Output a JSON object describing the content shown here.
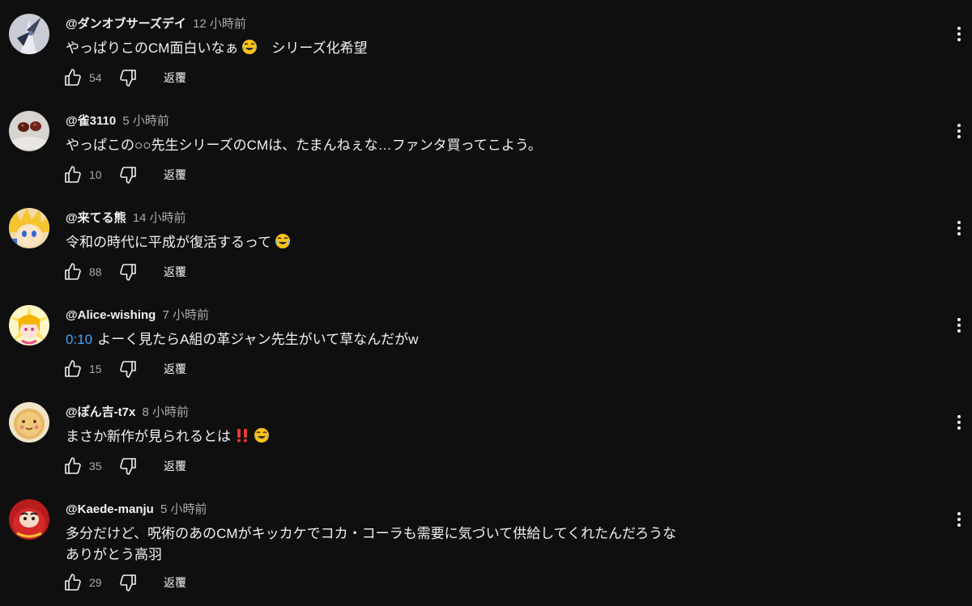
{
  "reply_label": "返覆",
  "comments": [
    {
      "author": "@ダンオブサーズデイ",
      "time": "12 小時前",
      "timestamp": "",
      "text": "やっぱりこのCM面白いなぁ",
      "emoji_after_text": "face-with-tears-of-joy",
      "text_after_emoji": "　シリーズ化希望",
      "line2": "",
      "likes": "54",
      "avatar": "robot-avatar"
    },
    {
      "author": "@雀3110",
      "time": "5 小時前",
      "timestamp": "",
      "text": "やっぱこの○○先生シリーズのCMは、たまんねぇな…ファンタ買ってこよう。",
      "emoji_after_text": "",
      "text_after_emoji": "",
      "line2": "",
      "likes": "10",
      "avatar": "chocolates-avatar"
    },
    {
      "author": "@来てる熊",
      "time": "14 小時前",
      "timestamp": "",
      "text": "令和の時代に平成が復活するって",
      "emoji_after_text": "face-with-tears-of-joy",
      "text_after_emoji": "",
      "line2": "",
      "likes": "88",
      "avatar": "anime-blonde-avatar"
    },
    {
      "author": "@Alice-wishing",
      "time": "7 小時前",
      "timestamp": "0:10",
      "text": "よーく見たらA組の革ジャン先生がいて草なんだがw",
      "emoji_after_text": "",
      "text_after_emoji": "",
      "line2": "",
      "likes": "15",
      "avatar": "anime-pink-avatar"
    },
    {
      "author": "@ぽん吉-t7x",
      "time": "8 小時前",
      "timestamp": "",
      "text": "まさか新作が見られるとは",
      "emoji_after_text": "double-exclamation",
      "text_after_emoji": "",
      "emoji2": "face-with-tears-of-joy",
      "line2": "",
      "likes": "35",
      "avatar": "cake-avatar"
    },
    {
      "author": "@Kaede-manju",
      "time": "5 小時前",
      "timestamp": "",
      "text": "多分だけど、呪術のあのCMがキッカケでコカ・コーラも需要に気づいて供給してくれたんだろうな",
      "emoji_after_text": "",
      "text_after_emoji": "",
      "line2": "ありがとう高羽",
      "likes": "29",
      "avatar": "daruma-avatar"
    }
  ]
}
